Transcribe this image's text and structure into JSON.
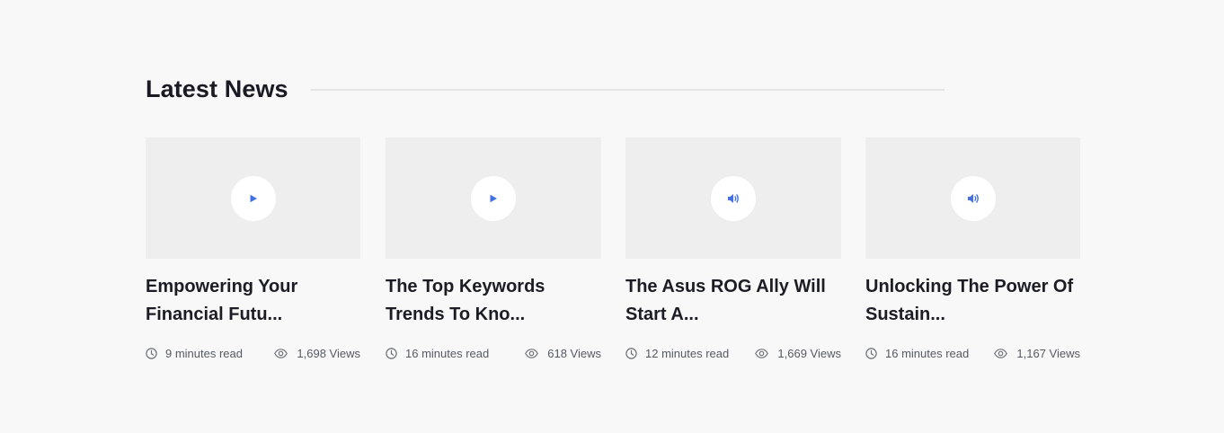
{
  "section": {
    "title": "Latest News"
  },
  "colors": {
    "accent": "#4470e6",
    "background": "#f8f8f8",
    "thumbnail": "#eeeeee"
  },
  "cards": [
    {
      "title_line1": "Empowering Your",
      "title_line2": "Financial Futu...",
      "media_icon": "play-icon",
      "read_time": "9 minutes read",
      "views": "1,698 Views"
    },
    {
      "title_line1": "The Top Keywords",
      "title_line2": "Trends To Kno...",
      "media_icon": "play-icon",
      "read_time": "16 minutes read",
      "views": "618 Views"
    },
    {
      "title_line1": "The Asus ROG Ally Will",
      "title_line2": "Start A...",
      "media_icon": "speaker-icon",
      "read_time": "12 minutes read",
      "views": "1,669 Views"
    },
    {
      "title_line1": "Unlocking The Power Of",
      "title_line2": "Sustain...",
      "media_icon": "speaker-icon",
      "read_time": "16 minutes read",
      "views": "1,167 Views"
    }
  ]
}
